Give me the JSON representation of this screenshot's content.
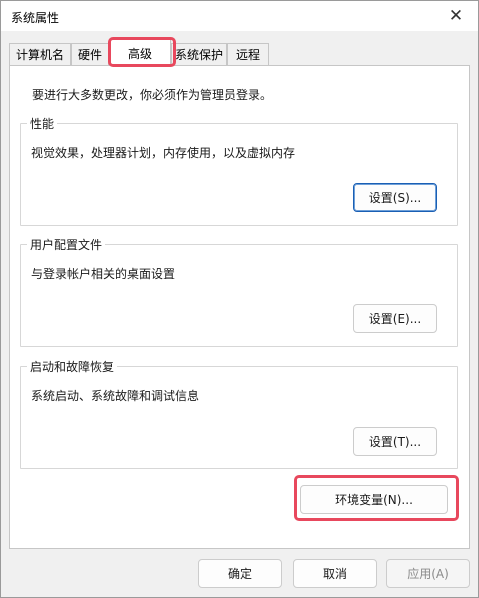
{
  "window": {
    "title": "系统属性",
    "close_glyph": "✕"
  },
  "tabs": [
    {
      "label": "计算机名"
    },
    {
      "label": "硬件"
    },
    {
      "label": "高级",
      "selected": true
    },
    {
      "label": "系统保护"
    },
    {
      "label": "远程"
    }
  ],
  "advanced": {
    "intro": "要进行大多数更改，你必须作为管理员登录。",
    "performance": {
      "legend": "性能",
      "description": "视觉效果，处理器计划，内存使用，以及虚拟内存",
      "button": "设置(S)..."
    },
    "user_profiles": {
      "legend": "用户配置文件",
      "description": "与登录帐户相关的桌面设置",
      "button": "设置(E)..."
    },
    "startup_recovery": {
      "legend": "启动和故障恢复",
      "description": "系统启动、系统故障和调试信息",
      "button": "设置(T)..."
    },
    "env_button": "环境变量(N)..."
  },
  "footer": {
    "ok": "确定",
    "cancel": "取消",
    "apply": "应用(A)"
  },
  "colors": {
    "highlight": "#e8485d",
    "default_button_border": "#1a5fb4"
  }
}
